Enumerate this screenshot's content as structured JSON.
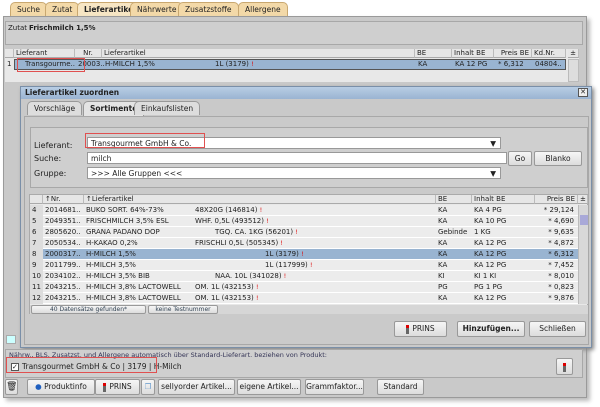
{
  "tabs": [
    "Suche",
    "Zutat",
    "Lieferartikel",
    "Nährwerte",
    "Zusatzstoffe",
    "Allergene"
  ],
  "zutat": {
    "label": "Zutat",
    "value": "Frischmilch 1,5%"
  },
  "top_table": {
    "columns": [
      "Lieferant",
      "Nr.",
      "Lieferartikel",
      "BE",
      "Inhalt BE",
      "Preis BE",
      "Kd.Nr."
    ],
    "rows": [
      {
        "n": "1",
        "lieferant": "Transgourme..",
        "nr": "20003..",
        "artikel": "H-MILCH 1,5%",
        "menge": "1L (3179)",
        "be": "KA",
        "inhalt": "KA 12 PG",
        "preis": "* 6,312",
        "kdnr": "04804.."
      }
    ],
    "sort_icon": "±"
  },
  "dialog": {
    "title": "Lieferartikel zuordnen",
    "tabs": [
      "Vorschläge",
      "Sortimente",
      "Einkaufslisten"
    ],
    "lieferant_label": "Lieferant:",
    "lieferant_value": "Transgourmet GmbH & Co.",
    "suche_label": "Suche:",
    "suche_value": "milch",
    "go": "Go",
    "blanko": "Blanko",
    "gruppe_label": "Gruppe:",
    "gruppe_value": ">>> Alle Gruppen <<<",
    "columns": [
      "Nr.",
      "Lieferartikel",
      "BE",
      "Inhalt BE",
      "Preis BE"
    ],
    "rows": [
      {
        "n": "4",
        "nr": "2014681..",
        "artikel": "BUKO SORT. 64%-73%",
        "menge": "48X20G (146814)",
        "be": "KA",
        "inhalt": "KA 4 PG",
        "preis": "* 29,124"
      },
      {
        "n": "5",
        "nr": "2049351..",
        "artikel": "FRISCHMILCH 3,5% ESL",
        "menge": "WHF. 0,5L (493512)",
        "be": "KA",
        "inhalt": "KA 10 PG",
        "preis": "* 4,690"
      },
      {
        "n": "6",
        "nr": "2805620..",
        "artikel": "GRANA PADANO DOP",
        "menge": "TGQ. CA. 1KG (56201)",
        "be": "Gebinde",
        "inhalt": "1 KG",
        "preis": "* 9,635"
      },
      {
        "n": "7",
        "nr": "2050534..",
        "artikel": "H-KAKAO 0,2%",
        "menge": "FRISCHLI 0,5L (505345)",
        "be": "KA",
        "inhalt": "KA 12 PG",
        "preis": "* 4,872"
      },
      {
        "n": "8",
        "nr": "2000317..",
        "artikel": "H-MILCH 1,5%",
        "menge": "1L (3179)",
        "be": "KA",
        "inhalt": "KA 12 PG",
        "preis": "* 6,312",
        "selected": true
      },
      {
        "n": "9",
        "nr": "2011799..",
        "artikel": "H-MILCH 3,5%",
        "menge": "1L (117999)",
        "be": "KA",
        "inhalt": "KA 12 PG",
        "preis": "* 7,452"
      },
      {
        "n": "10",
        "nr": "2034102..",
        "artikel": "H-MILCH 3,5% BIB",
        "menge": "NAA. 10L (341028)",
        "be": "KI",
        "inhalt": "KI 1 KI",
        "preis": "* 8,010"
      },
      {
        "n": "11",
        "nr": "2043215..",
        "artikel": "H-MILCH 3,8% LACTOWELL",
        "menge": "OM. 1L (432153)",
        "be": "PG",
        "inhalt": "PG 1 PG",
        "preis": "* 0,823"
      },
      {
        "n": "12",
        "nr": "2043215..",
        "artikel": "H-MILCH 3,8% LACTOWELL",
        "menge": "OM. 1L (432153)",
        "be": "KA",
        "inhalt": "KA 12 PG",
        "preis": "* 9,876"
      }
    ],
    "status_count": "40 Datensätze gefunden*",
    "status_test": "keine Testnummer",
    "prins": "PRINS",
    "hinzufuegen": "Hinzufügen...",
    "schliessen": "Schließen"
  },
  "bottom": {
    "auto_label": "Nährw., BLS, Zusatzst. und Allergene automatisch über Standard-Lieferart. beziehen von Produkt:",
    "checkbox_label": "Transgourmet GmbH & Co | 3179 | H-Milch",
    "checked": true,
    "buttons": [
      "Produktinfo",
      "PRINS",
      "sellyorder Artikel...",
      "eigene Artikel...",
      "Grammfaktor...",
      "Standard"
    ]
  }
}
